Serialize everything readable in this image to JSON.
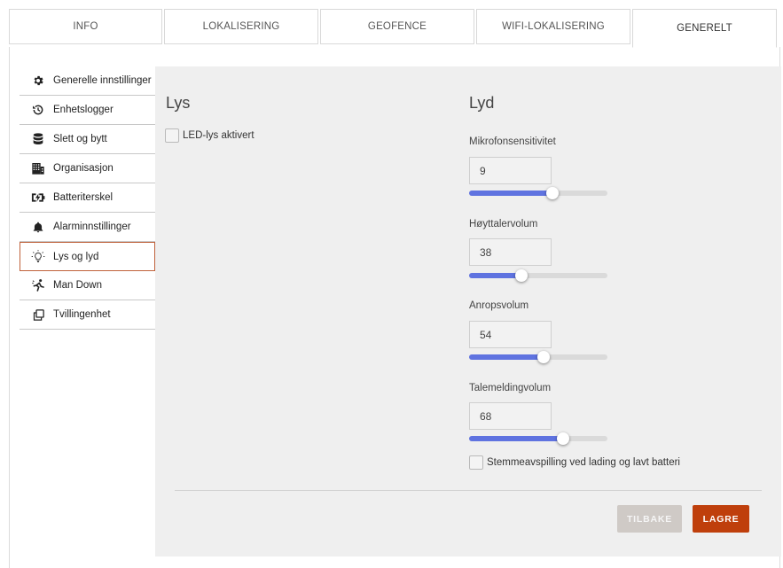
{
  "tabs": [
    {
      "label": "INFO"
    },
    {
      "label": "LOKALISERING"
    },
    {
      "label": "GEOFENCE"
    },
    {
      "label": "WIFI-LOKALISERING"
    },
    {
      "label": "GENERELT",
      "active": true
    }
  ],
  "sidebar": {
    "items": [
      {
        "label": "Generelle innstillinger",
        "icon": "gear-icon"
      },
      {
        "label": "Enhetslogger",
        "icon": "history-icon"
      },
      {
        "label": "Slett og bytt",
        "icon": "database-icon"
      },
      {
        "label": "Organisasjon",
        "icon": "building-icon"
      },
      {
        "label": "Batteriterskel",
        "icon": "battery-charging-icon"
      },
      {
        "label": "Alarminnstillinger",
        "icon": "bell-icon"
      },
      {
        "label": "Lys og lyd",
        "icon": "lightbulb-icon",
        "active": true
      },
      {
        "label": "Man Down",
        "icon": "falling-person-icon"
      },
      {
        "label": "Tvillingenhet",
        "icon": "copy-icon"
      }
    ]
  },
  "lys": {
    "title": "Lys",
    "led_label": "LED-lys aktivert",
    "led_checked": false
  },
  "lyd": {
    "title": "Lyd",
    "mic": {
      "label": "Mikrofonsensitivitet",
      "value": "9",
      "level": 0.6
    },
    "speaker": {
      "label": "Høyttalervolum",
      "value": "38",
      "level": 0.38
    },
    "call": {
      "label": "Anropsvolum",
      "value": "54",
      "level": 0.54
    },
    "voicemsg": {
      "label": "Talemeldingvolum",
      "value": "68",
      "level": 0.68
    },
    "voice_playback_label": "Stemmeavspilling ved lading og lavt batteri",
    "voice_playback_checked": false
  },
  "actions": {
    "back_label": "TILBAKE",
    "save_label": "LAGRE"
  },
  "colors": {
    "accent": "#bf3f0c",
    "slider": "#5f73e0",
    "active_border": "#c0623b"
  }
}
